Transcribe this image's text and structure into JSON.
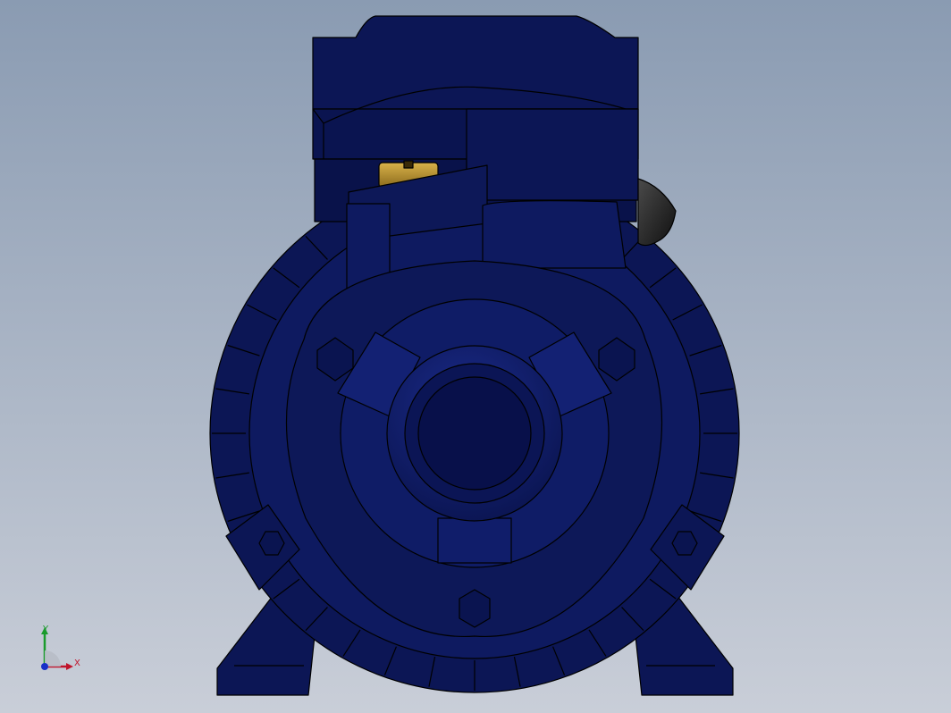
{
  "viewport": {
    "background_top": "#8a9bb2",
    "background_bottom": "#c9ced8"
  },
  "model": {
    "body_color": "#0c1655",
    "body_shade": "#060c38",
    "body_highlight": "#1b2b8a",
    "edge_color": "#000000",
    "fitting_color": "#b8922e",
    "plug_color": "#1e1e1e"
  },
  "triad": {
    "x_label": "X",
    "y_label": "Y",
    "x_color": "#c0142c",
    "y_color": "#1a9b2c",
    "z_color": "#1830c8"
  }
}
